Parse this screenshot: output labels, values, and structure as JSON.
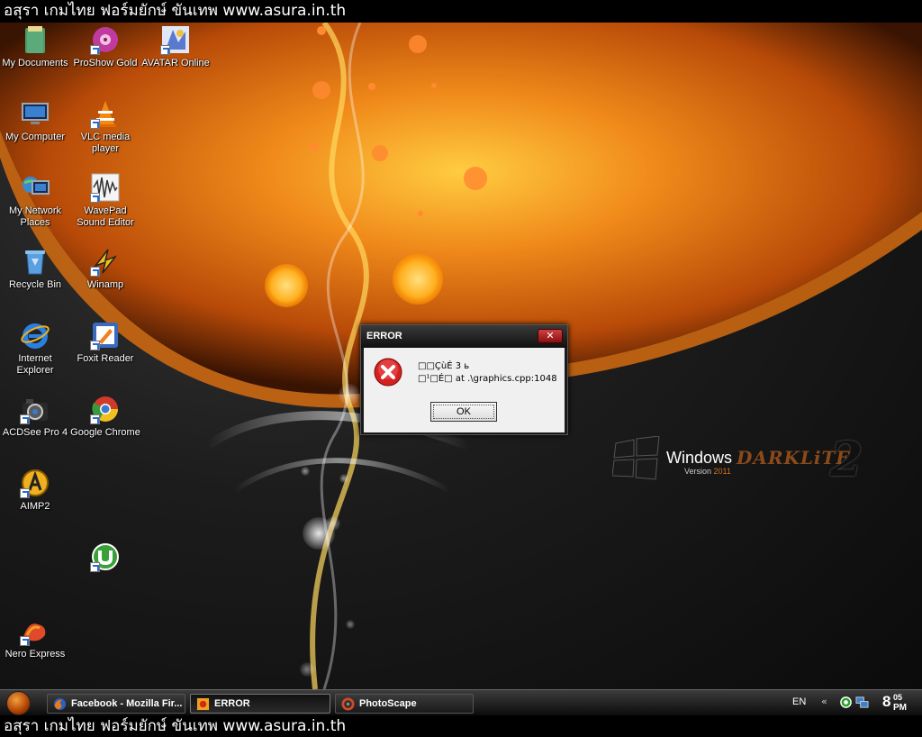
{
  "banner": {
    "top_text": "อสุรา เกมไทย ฟอร์มยักษ์ ขันเทพ www.asura.in.th",
    "bottom_text": "อสุรา เกมไทย ฟอร์มยักษ์ ขันเทพ www.asura.in.th"
  },
  "desktop": {
    "icons": [
      {
        "label": "My Documents",
        "icon": "my-documents-icon"
      },
      {
        "label": "ProShow Gold",
        "icon": "proshow-gold-icon"
      },
      {
        "label": "AVATAR Online",
        "icon": "avatar-online-icon"
      },
      {
        "label": "My Computer",
        "icon": "my-computer-icon"
      },
      {
        "label": "VLC media player",
        "icon": "vlc-icon"
      },
      {
        "label": "My Network Places",
        "icon": "network-places-icon"
      },
      {
        "label": "WavePad Sound Editor",
        "icon": "wavepad-icon"
      },
      {
        "label": "Recycle Bin",
        "icon": "recycle-bin-icon"
      },
      {
        "label": "Winamp",
        "icon": "winamp-icon"
      },
      {
        "label": "Internet Explorer",
        "icon": "internet-explorer-icon"
      },
      {
        "label": "Foxit Reader",
        "icon": "foxit-reader-icon"
      },
      {
        "label": "ACDSee Pro 4",
        "icon": "acdsee-icon"
      },
      {
        "label": "Google Chrome",
        "icon": "google-chrome-icon"
      },
      {
        "label": "AIMP2",
        "icon": "aimp2-icon"
      },
      {
        "label": "",
        "icon": "utorrent-icon"
      },
      {
        "label": "Nero Express",
        "icon": "nero-express-icon"
      }
    ],
    "wallpaper_logo": {
      "windows": "Windows",
      "version": "Version",
      "year": "2011",
      "edition": "DARKLiTE",
      "number": "2"
    }
  },
  "dialog": {
    "title": "ERROR",
    "close_label": "✕",
    "message_line1": "□□ÇùÉ 3 ь",
    "message_line2": "□¹□É□ at .\\graphics.cpp:1048",
    "ok_label": "OK"
  },
  "taskbar": {
    "tasks": [
      {
        "label": "Facebook - Mozilla Fir...",
        "icon": "firefox-icon",
        "active": false
      },
      {
        "label": "ERROR",
        "icon": "app-icon",
        "active": true
      },
      {
        "label": "PhotoScape",
        "icon": "photoscape-icon",
        "active": false
      }
    ],
    "language": "EN",
    "tray_chevron": "«",
    "clock_hour": "8",
    "clock_minute": "05",
    "clock_ampm": "PM"
  },
  "colors": {
    "accent_orange": "#e87a1a",
    "close_red": "#c02020",
    "error_red": "#d42020"
  }
}
